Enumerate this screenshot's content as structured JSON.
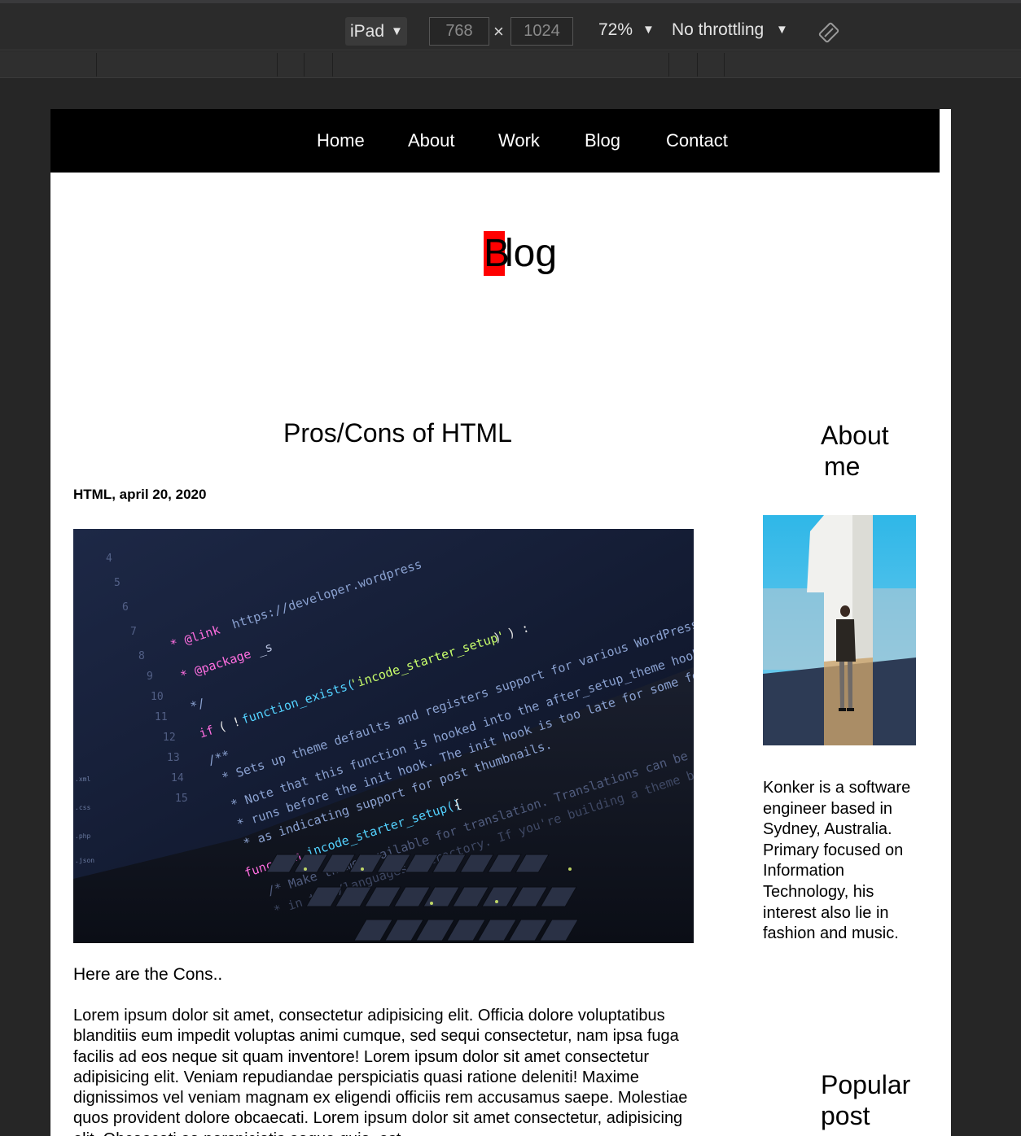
{
  "devtools": {
    "device": "iPad",
    "width": "768",
    "height": "1024",
    "zoom": "72%",
    "throttling": "No throttling",
    "times": "×"
  },
  "nav": {
    "items": [
      "Home",
      "About",
      "Work",
      "Blog",
      "Contact"
    ]
  },
  "page": {
    "title_first": "B",
    "title_rest": "log"
  },
  "post": {
    "title": "Pros/Cons of HTML",
    "meta": "HTML, april 20, 2020",
    "subheading": "Here are the Cons..",
    "body": "Lorem ipsum dolor sit amet, consectetur adipisicing elit. Officia dolore voluptatibus blanditiis eum impedit voluptas animi cumque, sed sequi consectetur, nam ipsa fuga facilis ad eos neque sit quam inventore! Lorem ipsum dolor sit amet consectetur adipisicing elit. Veniam repudiandae perspiciatis quasi ratione deleniti! Maxime dignissimos vel veniam magnam ex eligendi officiis rem accusamus saepe. Molestiae quos provident dolore obcaecati. Lorem ipsum dolor sit amet consectetur, adipisicing elit. Obcaecati ea perspiciatis eaque quia, est"
  },
  "sidebar": {
    "about_heading_line1": "About",
    "about_heading_line2": "me",
    "bio": "Konker is a software engineer based in Sydney, Australia. Primary focused on Information Technology, his interest also lie in fashion and music.",
    "popular_heading_line1": "Popular",
    "popular_heading_line2": "post"
  },
  "colors": {
    "nav_bg": "#000000",
    "title_highlight": "#ff0000",
    "devtools_bg": "#2b2b2b"
  }
}
